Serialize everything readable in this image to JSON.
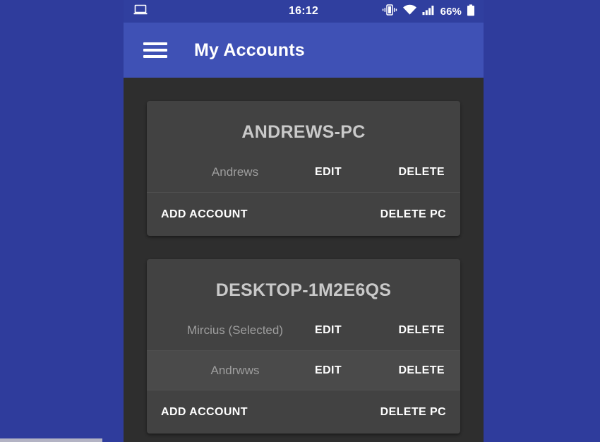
{
  "status_bar": {
    "notification_icon": "laptop-icon",
    "clock": "16:12",
    "icons": [
      "vibrate-icon",
      "wifi-icon",
      "signal-icon"
    ],
    "battery_percent": "66%",
    "battery_icon": "battery-icon",
    "background_color": "#303f9f",
    "text_color": "#ffffff"
  },
  "app_bar": {
    "menu_icon": "hamburger-menu-icon",
    "title": "My Accounts",
    "background_color": "#3f51b5"
  },
  "theme": {
    "backdrop_color": "#2f3c9c",
    "screen_background": "#2e2e2e",
    "card_background": "#424242",
    "card_title_color": "#c9c9c9",
    "account_name_color": "#9e9e9e",
    "action_color": "#ffffff",
    "divider_color": "#4f4f4f",
    "row_highlight_color": "#4a4a4a"
  },
  "labels": {
    "edit": "EDIT",
    "delete": "DELETE",
    "add_account": "ADD ACCOUNT",
    "delete_pc": "DELETE PC"
  },
  "cards": [
    {
      "title": "ANDREWS-PC",
      "accounts": [
        {
          "name": "Andrews",
          "edit": "EDIT",
          "delete": "DELETE",
          "highlight": false
        }
      ],
      "footer": {
        "add_account": "ADD ACCOUNT",
        "delete_pc": "DELETE PC"
      }
    },
    {
      "title": "DESKTOP-1M2E6QS",
      "accounts": [
        {
          "name": "Mircius (Selected)",
          "edit": "EDIT",
          "delete": "DELETE",
          "highlight": false
        },
        {
          "name": "Andrwws",
          "edit": "EDIT",
          "delete": "DELETE",
          "highlight": true
        }
      ],
      "footer": {
        "add_account": "ADD ACCOUNT",
        "delete_pc": "DELETE PC"
      }
    }
  ]
}
